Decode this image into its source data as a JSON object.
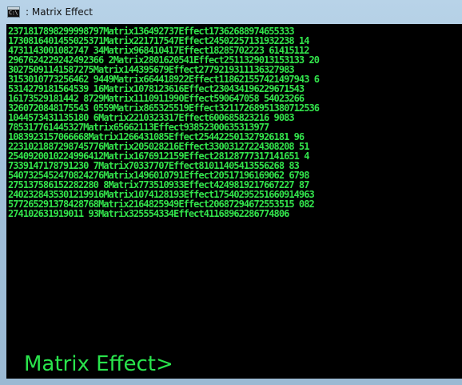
{
  "window": {
    "title": ": Matrix Effect",
    "icon": "cmd-window-icon",
    "icon_text": "C:\\"
  },
  "console": {
    "lines": [
      "2371817898299998797Matrix136492737Effect17362688974655333",
      "1730816401455025371Matrix221717547Effect24502257131932238 14",
      "4731143001082747 34Matrix968410417Effect18285702223 61415112",
      "2967624229242492366 2Matrix2801620541Effect2511329013153133 20",
      "30275091141587275Matrix144395679Effect2779219311136327983",
      "3153010773256462 9449Matrix664418922Effect118621557421497943 6",
      "5314279181564539 16Matrix1078123616Effect230434196229671543",
      "16173529181442 8729Matrix1110911990Effect590647058 54023266",
      "3260720848175543 0559Matrix865325519Effect32117268951380712536",
      "1044573431135180 6Matrix2210323317Effect600685823216 9083",
      "785317761445327Matrix65662113Effect93852300635313977",
      "1083923157066668Matrix1266431085Effect254422501327926181 96",
      "2231021887298745776Matrix205028216Effect33003127224308208 51",
      "2540920010224996412Matrix1676912159Effect28128777317141651 4",
      "7339147178791230 7Matrix70337707Effect81011405413556268 83",
      "5407325452470824276Matrix1496010791Effect20517196169062 6798",
      "275137586152282280 8Matrix773510933Effect4249819217667227 87",
      "2402328435301219916Matrix1074128193Effect17540295251660914963",
      "577265291378428768Matrix2164825949Effect20687294672553515 082",
      "274102631919011 93Matrix325554334Effect41168962286774806"
    ],
    "prompt": "Matrix Effect>",
    "text_color": "#32e34b",
    "background_color": "#000000"
  },
  "scrollbar": {
    "left_arrow": "scroll-left-arrow-icon",
    "right_arrow": "scroll-right-arrow-icon",
    "thumb_position": 0.0
  }
}
